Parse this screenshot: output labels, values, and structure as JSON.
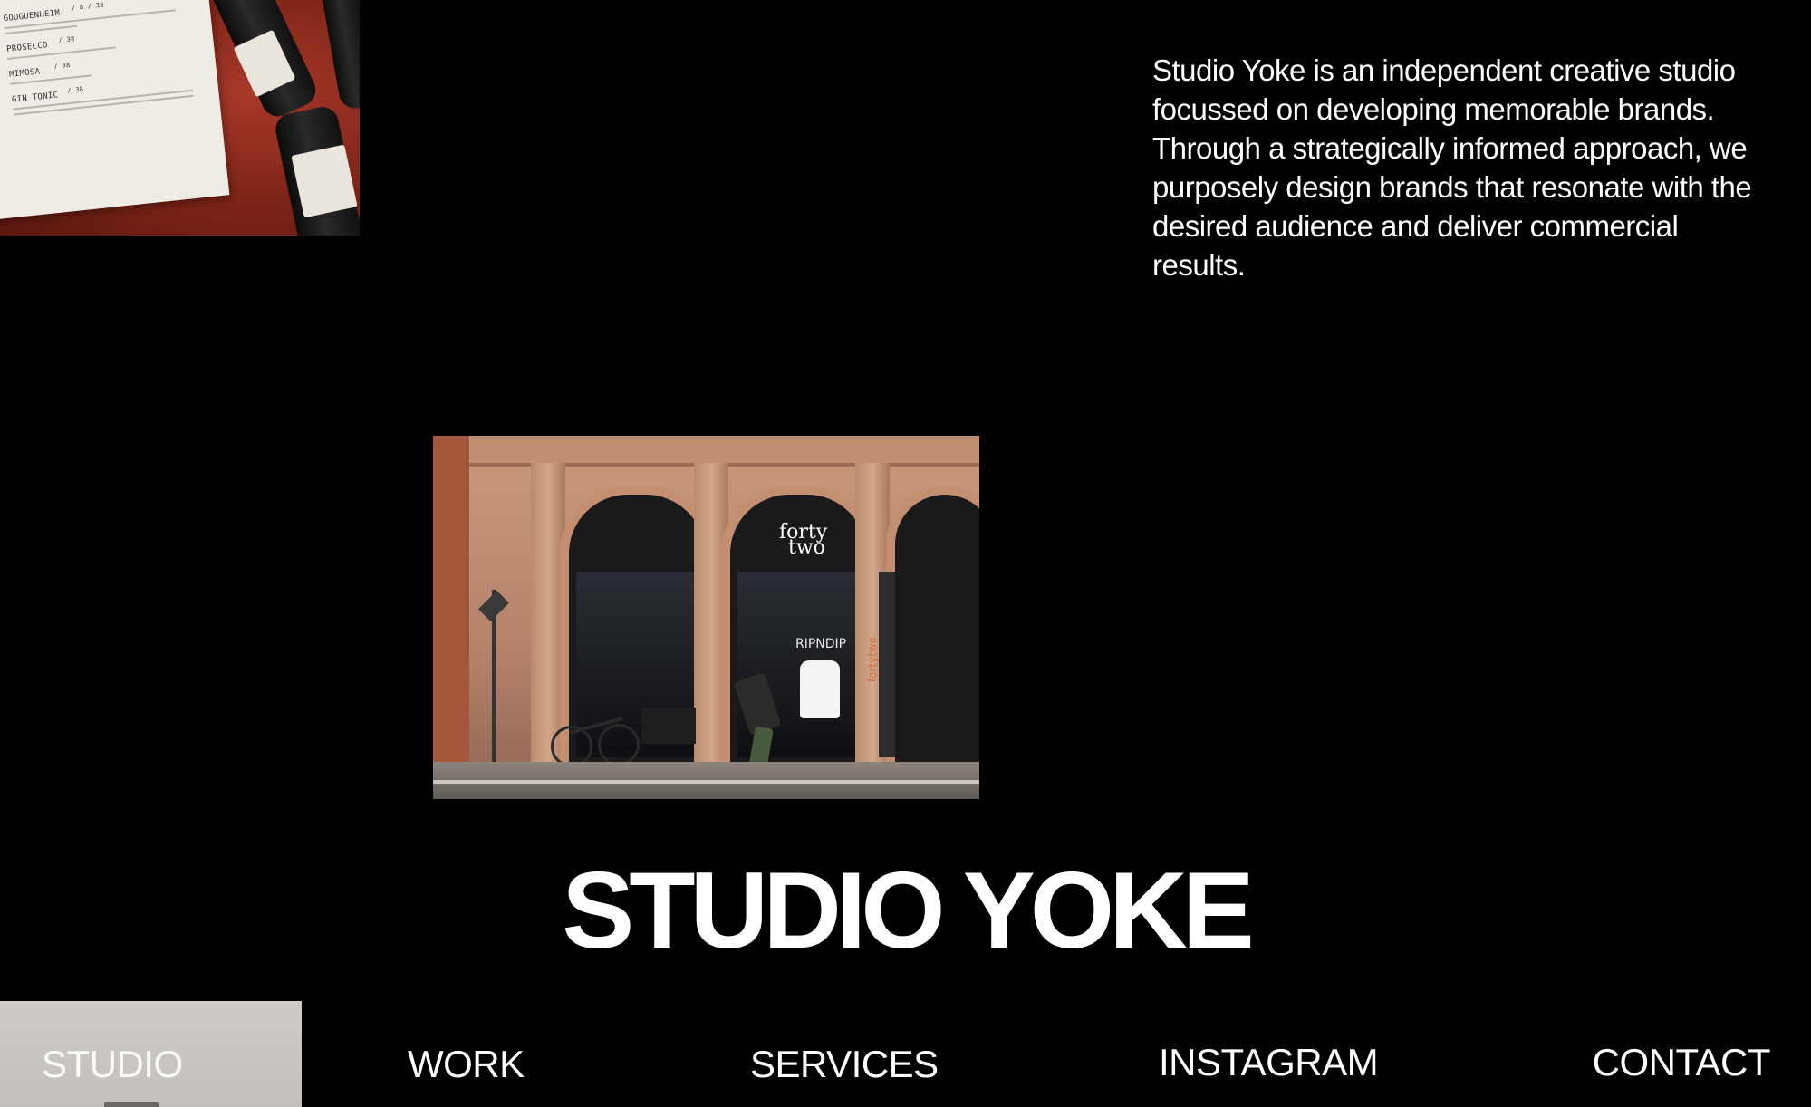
{
  "menu_card": {
    "items": [
      {
        "name": "GOUGUENHEIM",
        "price": "/ 8 / 38"
      },
      {
        "name": "PROSECCO",
        "price": "/ 38"
      },
      {
        "name": "MIMOSA",
        "price": "/ 38"
      },
      {
        "name": "GIN TONIC",
        "price": "/ 38"
      }
    ]
  },
  "intro": {
    "text": "Studio Yoke is an independent creative studio focussed on developing memorable brands. Through a strategically informed approach, we purposely design brands that resonate with the desired audience and deliver commercial results."
  },
  "storefront": {
    "sign_line1": "forty",
    "sign_line2": "two",
    "window_text": "RIPNDIP",
    "side_text": "fortytwo"
  },
  "wordmark": "STUDIO YOKE",
  "nav": {
    "studio": "STUDIO",
    "work": "WORK",
    "services": "SERVICES",
    "instagram": "INSTAGRAM",
    "contact": "CONTACT"
  },
  "colors": {
    "background": "#000000",
    "text": "#ffffff",
    "active_nav_bg": "#c9c6c2"
  }
}
